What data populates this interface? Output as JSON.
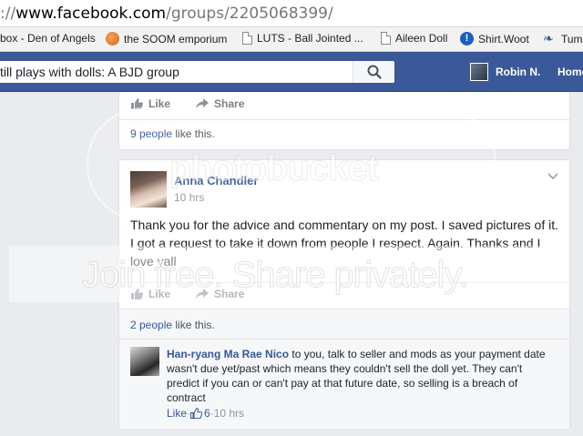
{
  "browser": {
    "url_host": "www.facebook.com",
    "url_path": "/groups/2205068399/",
    "url_prefix": "://"
  },
  "bookmarks": [
    {
      "label": "box - Den of Angels",
      "icon": "folder-icon"
    },
    {
      "label": "the SOOM emporium",
      "icon": "soom-icon"
    },
    {
      "label": "LUTS - Ball Jointed ...",
      "icon": "page-icon"
    },
    {
      "label": "Aileen Doll",
      "icon": "page-icon"
    },
    {
      "label": "Shirt.Woot",
      "icon": "woot-icon"
    },
    {
      "label": "Tum",
      "icon": "tumblr-icon"
    }
  ],
  "fb_header": {
    "search_value": "till plays with dolls: A BJD group",
    "user_name": "Robin N.",
    "home_label": "Home"
  },
  "top_post": {
    "like_label": "Like",
    "share_label": "Share",
    "likes_count": "9 people",
    "likes_suffix": " like this."
  },
  "post": {
    "author": "Anna Chandler",
    "time": "10 hrs",
    "body": "Thank you for the advice and commentary on my post. I saved pictures of it. I got a request to take it down from people I respect. Again. Thanks and I love yall",
    "like_label": "Like",
    "share_label": "Share",
    "likes_count": "2 people",
    "likes_suffix": " like this."
  },
  "comment": {
    "author": "Han-ryang Ma Rae Nico",
    "text": " to you, talk to seller and mods as your payment date wasn't due yet/past which means they couldn't sell the doll yet. They can't predict if you can or can't pay at that future date, so selling is a breach of contract",
    "like_label": "Like",
    "like_count": "6",
    "separator": " · ",
    "time": "10 hrs"
  },
  "watermark": {
    "brand": "photobucket",
    "tagline": "Join free. Share privately."
  },
  "colors": {
    "fb_blue": "#3b5998",
    "link_blue": "#365899",
    "page_bg": "#e9ebee"
  }
}
